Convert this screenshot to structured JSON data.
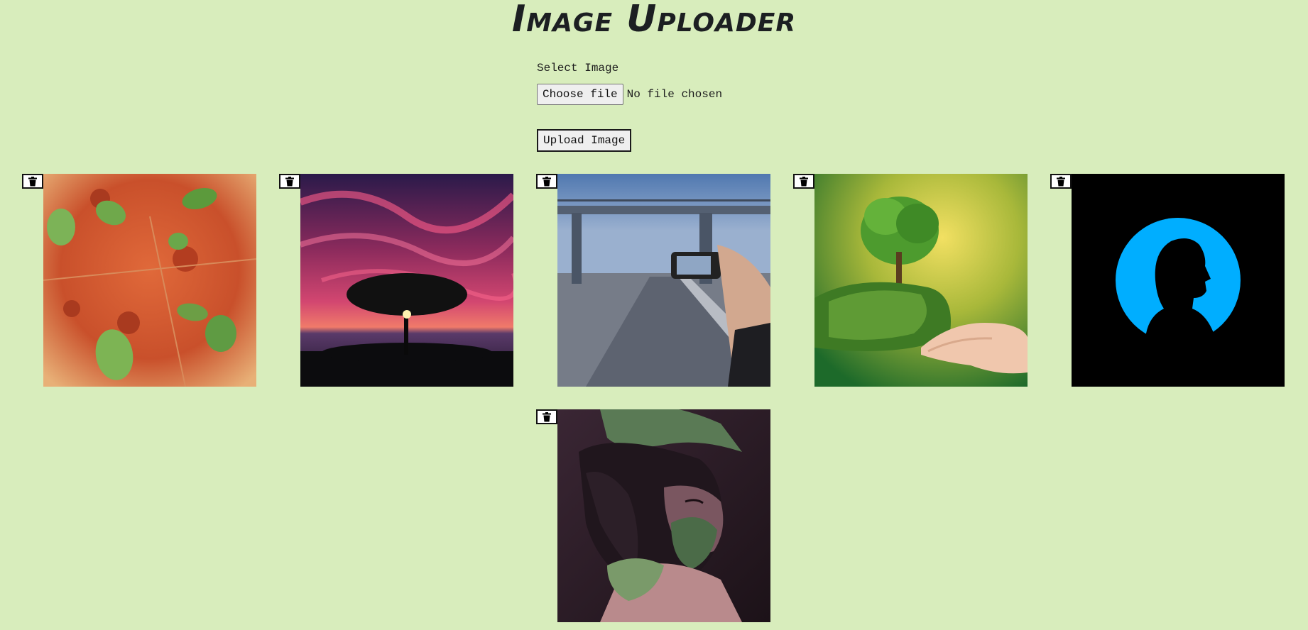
{
  "page": {
    "title": "Image Uploader",
    "background": "#d8edbc"
  },
  "form": {
    "select_label": "Select Image",
    "choose_button": "Choose file",
    "file_status": "No file chosen",
    "upload_button": "Upload Image"
  },
  "gallery": {
    "delete_icon": "trash-icon",
    "images": [
      {
        "subject": "pizza"
      },
      {
        "subject": "tree-sunset"
      },
      {
        "subject": "bridge-phone"
      },
      {
        "subject": "tree-in-hand"
      },
      {
        "subject": "profile-silhouette"
      },
      {
        "subject": "masked-character"
      }
    ]
  }
}
